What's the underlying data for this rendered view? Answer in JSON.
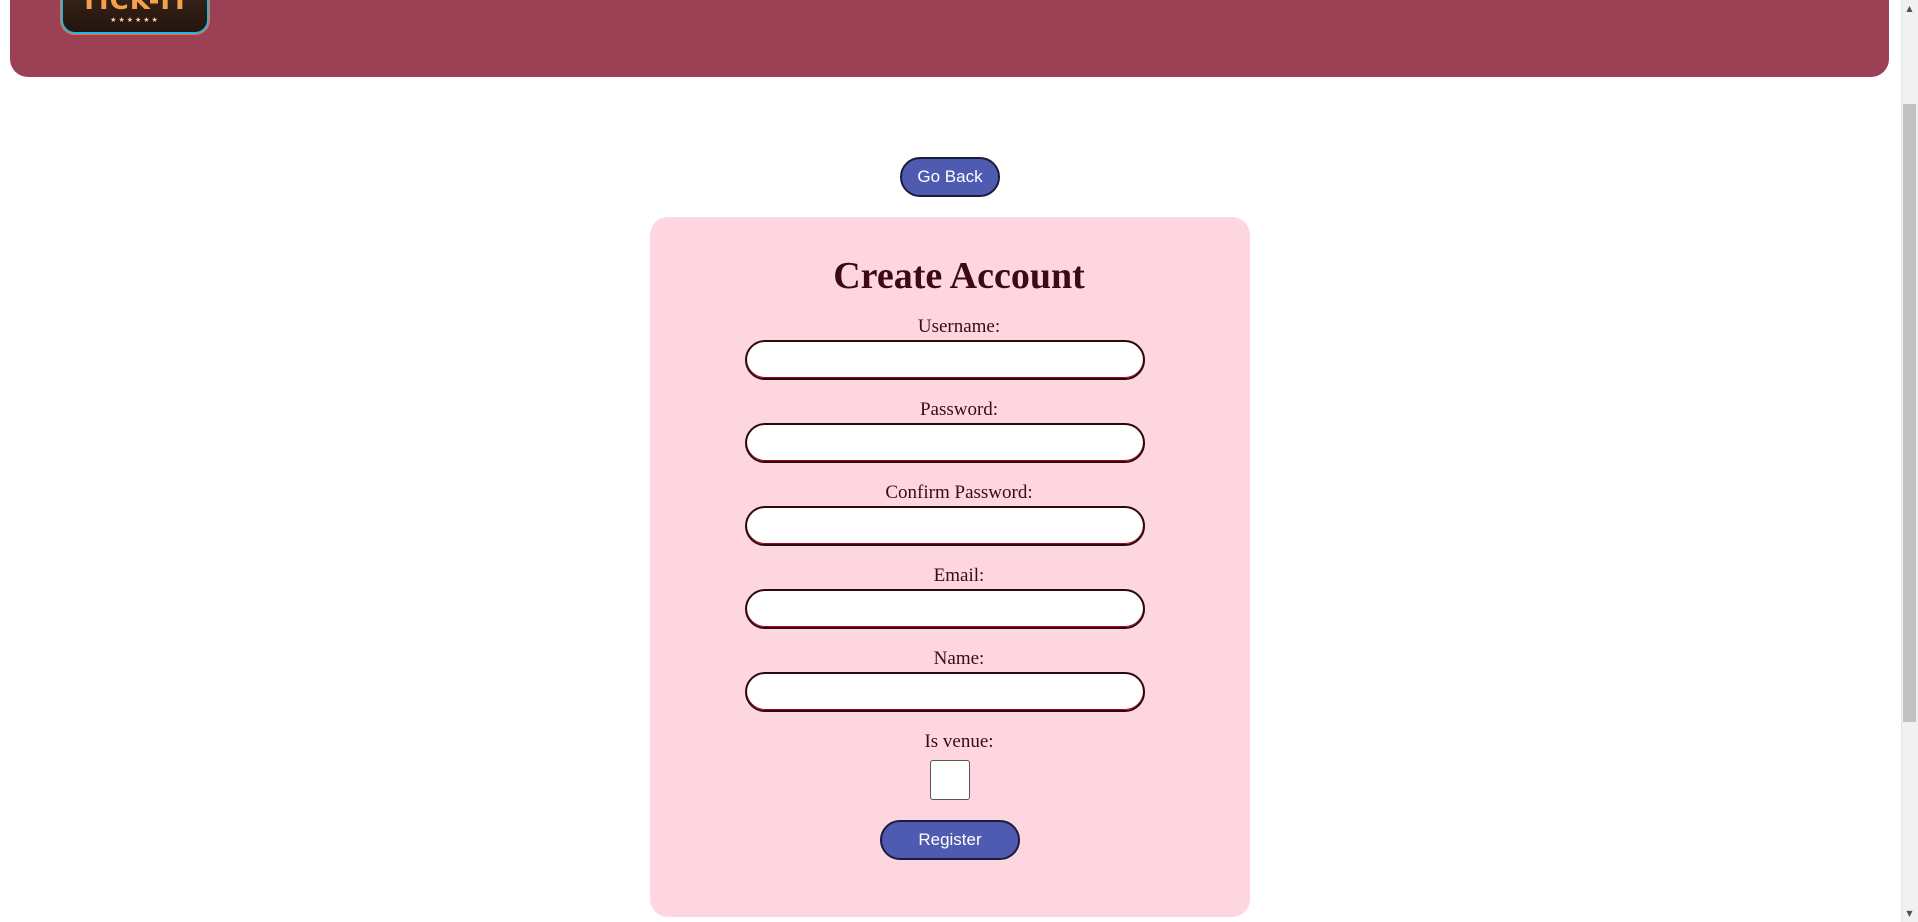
{
  "header": {
    "logo_text": "TICK-IT",
    "logo_subtext": "★★★★★★",
    "background_color": "#9b4055"
  },
  "nav": {
    "go_back_label": "Go Back"
  },
  "form": {
    "title": "Create Account",
    "fields": [
      {
        "label": "Username:",
        "value": ""
      },
      {
        "label": "Password:",
        "value": ""
      },
      {
        "label": "Confirm Password:",
        "value": ""
      },
      {
        "label": "Email:",
        "value": ""
      },
      {
        "label": "Name:",
        "value": ""
      }
    ],
    "is_venue_label": "Is venue:",
    "is_venue_checked": false,
    "register_label": "Register"
  },
  "colors": {
    "card_background": "#fed6df",
    "button_background": "#4f5bb0",
    "text_dark": "#3b0a16"
  },
  "icons": {
    "scroll_up": "triangle-up-icon",
    "scroll_down": "triangle-down-icon"
  }
}
